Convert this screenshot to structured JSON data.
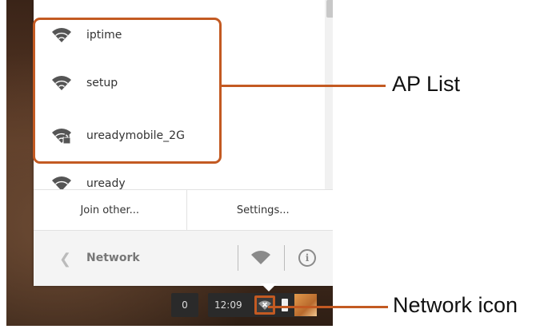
{
  "ap_list": {
    "items": [
      {
        "name": "iptime",
        "secured": false
      },
      {
        "name": "setup",
        "secured": false
      },
      {
        "name": "ureadymobile_2G",
        "secured": true
      },
      {
        "name": "uready",
        "secured": false
      }
    ]
  },
  "actions": {
    "join_other": "Join other...",
    "settings": "Settings..."
  },
  "network_bar": {
    "back_icon": "chevron-left-icon",
    "label": "Network"
  },
  "shelf": {
    "notification_count": "0",
    "time": "12:09"
  },
  "annotations": {
    "ap_list": "AP List",
    "network_icon": "Network icon"
  },
  "colors": {
    "accent": "#c35a22",
    "wifi_icon": "#555555"
  }
}
